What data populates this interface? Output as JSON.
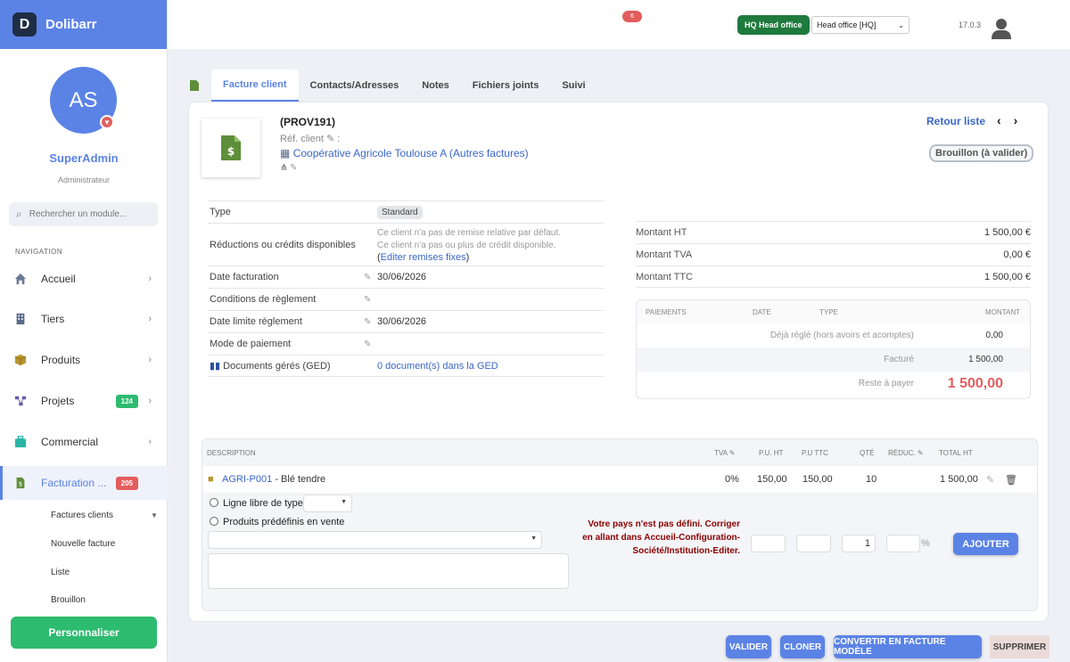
{
  "app": {
    "name": "Dolibarr",
    "logo_letter": "D",
    "version": "17.0.3",
    "notifications": "6"
  },
  "user": {
    "initials": "AS",
    "name": "SuperAdmin",
    "role": "Administrateur"
  },
  "search": {
    "placeholder": "Rechercher un module..."
  },
  "nav": {
    "title": "NAVIGATION",
    "items": [
      {
        "label": "Accueil",
        "icon": "home-icon"
      },
      {
        "label": "Tiers",
        "icon": "building-icon"
      },
      {
        "label": "Produits",
        "icon": "box-icon"
      },
      {
        "label": "Projets",
        "icon": "project-icon",
        "badge": "124"
      },
      {
        "label": "Commercial",
        "icon": "briefcase-icon"
      },
      {
        "label": "Facturation ...",
        "icon": "invoice-icon",
        "badge": "205"
      }
    ],
    "sub_items": [
      "Factures clients",
      "Nouvelle facture",
      "Liste",
      "Brouillon"
    ],
    "customize": "Personnaliser"
  },
  "topbar": {
    "entity_label": "HQ Head office",
    "entity_select": "Head office [HQ]"
  },
  "tabs": [
    "Facture client",
    "Contacts/Adresses",
    "Notes",
    "Fichiers joints",
    "Suivi"
  ],
  "invoice": {
    "ref": "(PROV191)",
    "ref_client_label": "Réf. client",
    "ref_client_suffix": ":",
    "thirdparty": "Coopérative Agricole Toulouse A (Autres factures)",
    "back_list": "Retour liste",
    "status": "Brouillon (à valider)"
  },
  "info": {
    "type_label": "Type",
    "type_value": "Standard",
    "reductions_label": "Réductions ou crédits disponibles",
    "reductions_line1": "Ce client n'a pas de remise relative par défaut.",
    "reductions_line2": "Ce client n'a pas ou plus de crédit disponible.",
    "reductions_link_open": "(",
    "reductions_link": "Editer remises fixes",
    "reductions_link_close": ")",
    "date_label": "Date facturation",
    "date_value": "30/06/2026",
    "conditions_label": "Conditions de règlement",
    "due_label": "Date limite règlement",
    "due_value": "30/06/2026",
    "mode_label": "Mode de paiement",
    "ged_label": "Documents gérés (GED)",
    "ged_value": "0 document(s) dans la GED"
  },
  "amounts": {
    "ht_label": "Montant HT",
    "ht": "1 500,00 €",
    "tva_label": "Montant TVA",
    "tva": "0,00 €",
    "ttc_label": "Montant TTC",
    "ttc": "1 500,00 €"
  },
  "payments": {
    "headers": [
      "PAIEMENTS",
      "DATE",
      "TYPE",
      "MONTANT"
    ],
    "already_label": "Déjà réglé (hors avoirs et acomptes)",
    "already": "0,00",
    "billed_label": "Facturé",
    "billed": "1 500,00",
    "remaining_label": "Reste à payer",
    "remaining": "1 500,00"
  },
  "lines": {
    "headers": {
      "desc": "DESCRIPTION",
      "tva": "TVA",
      "pu_ht": "P.U. HT",
      "pu_ttc": "P.U TTC",
      "qty": "QTÉ",
      "reduc": "RÉDUC.",
      "total": "TOTAL HT"
    },
    "row": {
      "code": "AGRI-P001",
      "label": "- Blé tendre",
      "tva": "0%",
      "pu_ht": "150,00",
      "pu_ttc": "150,00",
      "qty": "10",
      "total": "1 500,00"
    },
    "free_line": "Ligne libre de type",
    "predef": "Produits prédéfinis en vente",
    "qty_default": "1",
    "percent": "%",
    "warning": "Votre pays n'est pas défini. Corriger en allant dans Accueil-Configuration-Société/Institution-Editer.",
    "add": "AJOUTER"
  },
  "actions": {
    "validate": "VALIDER",
    "clone": "CLONER",
    "template": "CONVERTIR EN FACTURE MODÈLE",
    "delete": "SUPPRIMER"
  },
  "colors": {
    "accent": "#5b83e6",
    "success": "#2dbb6f",
    "danger": "#e35d5d",
    "entity": "#1f7a3d"
  }
}
